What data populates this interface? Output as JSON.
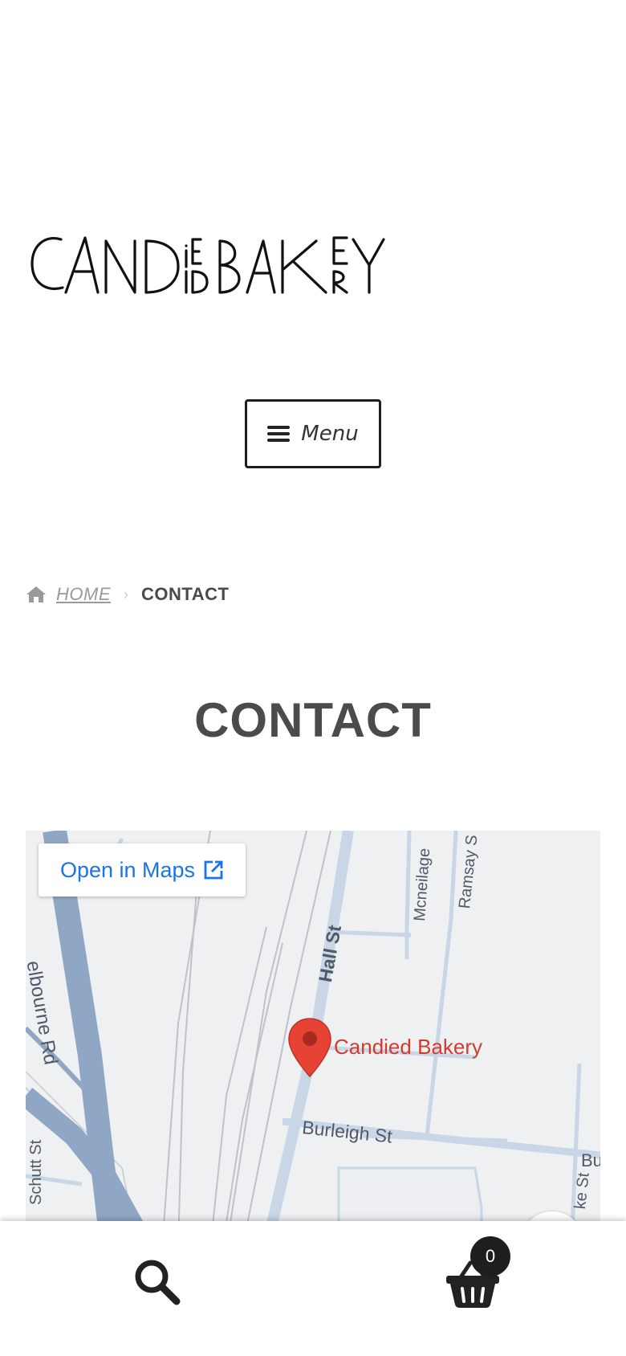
{
  "header": {
    "logo_text": "CANDIED BAKERY",
    "menu_label": "Menu"
  },
  "breadcrumb": {
    "home_icon": "home-icon",
    "home_label": "HOME",
    "separator": "›",
    "current_label": "CONTACT"
  },
  "page": {
    "title": "CONTACT"
  },
  "map": {
    "open_in_maps_label": "Open in Maps",
    "open_icon": "external-link-icon",
    "place_label": "Candied Bakery",
    "streets": {
      "melbourne_rd": "elbourne Rd",
      "hall_st": "Hall St",
      "mcneilage": "Mcneilage",
      "ramsay": "Ramsay S",
      "burleigh_st": "Burleigh St",
      "schutt_st": "Schutt St",
      "bu": "Bu",
      "ke_st": "ke St"
    },
    "colors": {
      "major_road": "#8fa7c4",
      "minor_road": "#c8d6e6",
      "pin": "#e74335",
      "label_red": "#d33b2c",
      "link_blue": "#1a73e8"
    }
  },
  "footer": {
    "search_icon": "search-icon",
    "cart_icon": "basket-icon",
    "cart_count": "0"
  }
}
